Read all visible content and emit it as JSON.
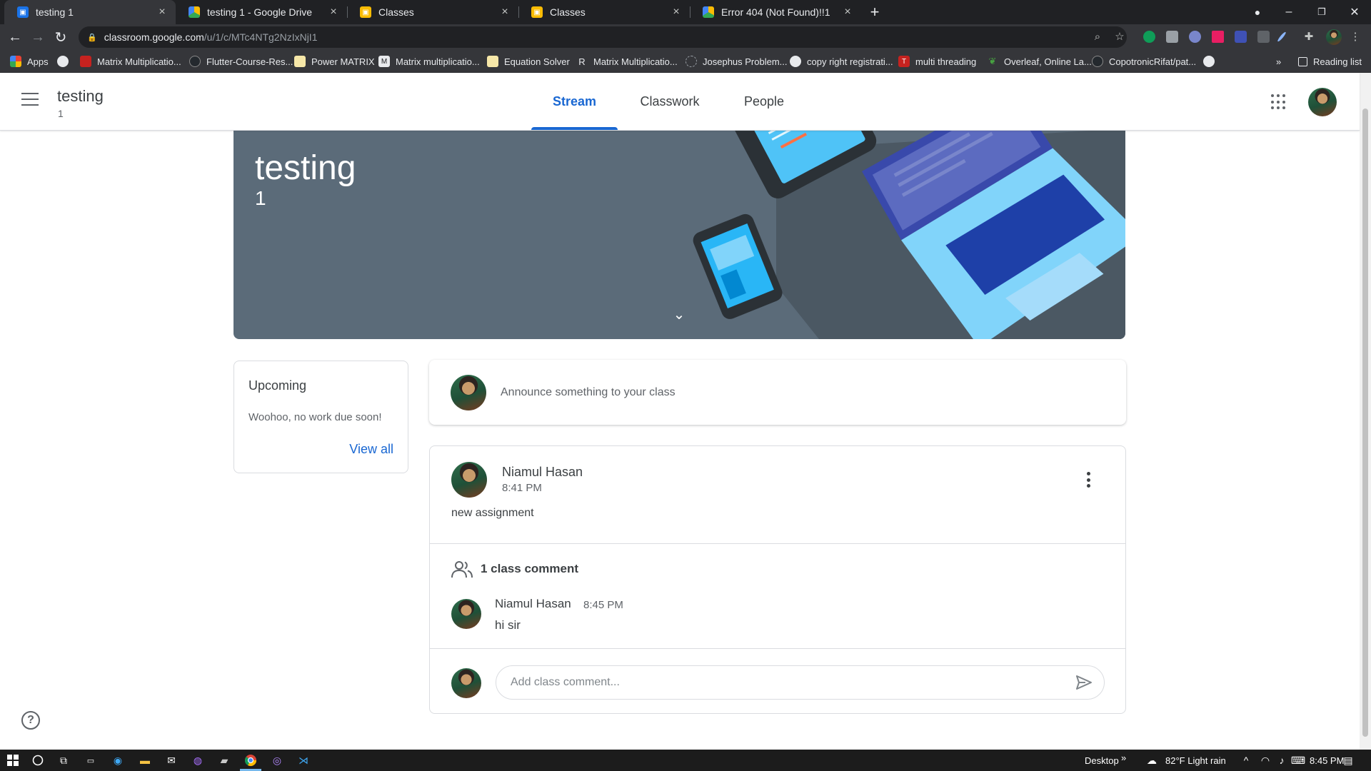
{
  "browser": {
    "tabs": [
      {
        "title": "testing 1",
        "favicon": "classroom-favicon-icon",
        "active": true
      },
      {
        "title": "testing 1 - Google Drive",
        "favicon": "drive-favicon-icon",
        "active": false
      },
      {
        "title": "Classes",
        "favicon": "classroom-favicon-icon",
        "active": false
      },
      {
        "title": "Classes",
        "favicon": "classroom-favicon-icon",
        "active": false
      },
      {
        "title": "Error 404 (Not Found)!!1",
        "favicon": "drive-favicon-icon",
        "active": false
      }
    ],
    "url_host": "classroom.google.com",
    "url_path": "/u/1/c/MTc4NTg2NzIxNjI1",
    "bookmarks": [
      "Apps",
      "Matrix Multiplicatio...",
      "Flutter-Course-Res...",
      "Power MATRIX",
      "Matrix multiplicatio...",
      "Equation Solver",
      "Matrix Multiplicatio...",
      "Josephus Problem...",
      "copy right registrati...",
      "multi threading",
      "Overleaf, Online La...",
      "CopotronicRifat/pat..."
    ],
    "reading_list": "Reading list",
    "overflow": "»"
  },
  "classroom": {
    "class_name": "testing",
    "section": "1",
    "nav_tabs": [
      "Stream",
      "Classwork",
      "People"
    ],
    "banner": {
      "title": "testing",
      "subtitle": "1"
    },
    "upcoming": {
      "heading": "Upcoming",
      "empty_text": "Woohoo, no work due soon!",
      "view_all": "View all"
    },
    "announce_placeholder": "Announce something to your class",
    "post": {
      "author": "Niamul Hasan",
      "time": "8:41 PM",
      "body": "new assignment",
      "comment_count": "1 class comment",
      "comments": [
        {
          "author": "Niamul Hasan",
          "time": "8:45 PM",
          "text": "hi sir"
        }
      ],
      "comment_placeholder": "Add class comment..."
    },
    "help": "?"
  },
  "taskbar": {
    "desktop": "Desktop",
    "weather": "82°F  Light rain",
    "time": "8:45 PM"
  },
  "colors": {
    "accent": "#1967d2",
    "banner": "#5b6b79"
  }
}
